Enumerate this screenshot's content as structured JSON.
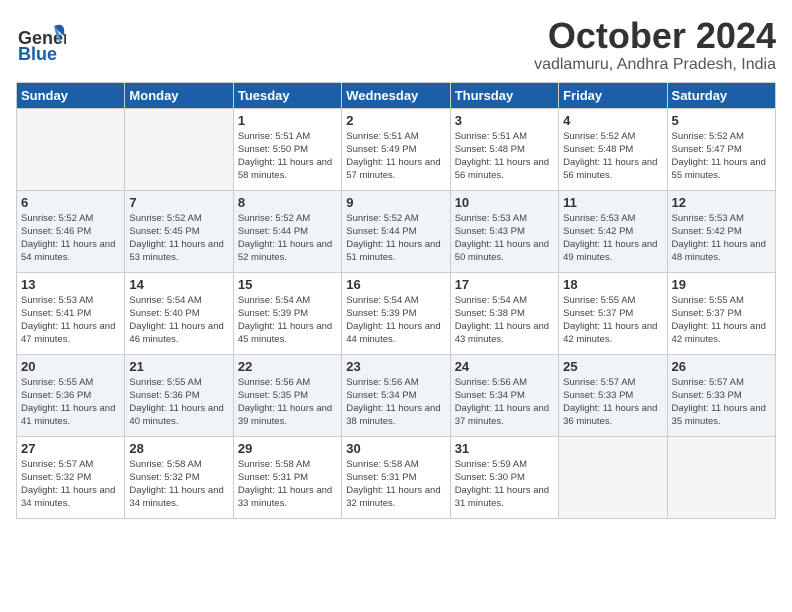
{
  "header": {
    "logo_general": "General",
    "logo_blue": "Blue",
    "month": "October 2024",
    "location": "vadlamuru, Andhra Pradesh, India"
  },
  "days_of_week": [
    "Sunday",
    "Monday",
    "Tuesday",
    "Wednesday",
    "Thursday",
    "Friday",
    "Saturday"
  ],
  "weeks": [
    [
      {
        "day": "",
        "empty": true
      },
      {
        "day": "",
        "empty": true
      },
      {
        "day": "1",
        "sunrise": "5:51 AM",
        "sunset": "5:50 PM",
        "daylight": "11 hours and 58 minutes."
      },
      {
        "day": "2",
        "sunrise": "5:51 AM",
        "sunset": "5:49 PM",
        "daylight": "11 hours and 57 minutes."
      },
      {
        "day": "3",
        "sunrise": "5:51 AM",
        "sunset": "5:48 PM",
        "daylight": "11 hours and 56 minutes."
      },
      {
        "day": "4",
        "sunrise": "5:52 AM",
        "sunset": "5:48 PM",
        "daylight": "11 hours and 56 minutes."
      },
      {
        "day": "5",
        "sunrise": "5:52 AM",
        "sunset": "5:47 PM",
        "daylight": "11 hours and 55 minutes."
      }
    ],
    [
      {
        "day": "6",
        "sunrise": "5:52 AM",
        "sunset": "5:46 PM",
        "daylight": "11 hours and 54 minutes."
      },
      {
        "day": "7",
        "sunrise": "5:52 AM",
        "sunset": "5:45 PM",
        "daylight": "11 hours and 53 minutes."
      },
      {
        "day": "8",
        "sunrise": "5:52 AM",
        "sunset": "5:44 PM",
        "daylight": "11 hours and 52 minutes."
      },
      {
        "day": "9",
        "sunrise": "5:52 AM",
        "sunset": "5:44 PM",
        "daylight": "11 hours and 51 minutes."
      },
      {
        "day": "10",
        "sunrise": "5:53 AM",
        "sunset": "5:43 PM",
        "daylight": "11 hours and 50 minutes."
      },
      {
        "day": "11",
        "sunrise": "5:53 AM",
        "sunset": "5:42 PM",
        "daylight": "11 hours and 49 minutes."
      },
      {
        "day": "12",
        "sunrise": "5:53 AM",
        "sunset": "5:42 PM",
        "daylight": "11 hours and 48 minutes."
      }
    ],
    [
      {
        "day": "13",
        "sunrise": "5:53 AM",
        "sunset": "5:41 PM",
        "daylight": "11 hours and 47 minutes."
      },
      {
        "day": "14",
        "sunrise": "5:54 AM",
        "sunset": "5:40 PM",
        "daylight": "11 hours and 46 minutes."
      },
      {
        "day": "15",
        "sunrise": "5:54 AM",
        "sunset": "5:39 PM",
        "daylight": "11 hours and 45 minutes."
      },
      {
        "day": "16",
        "sunrise": "5:54 AM",
        "sunset": "5:39 PM",
        "daylight": "11 hours and 44 minutes."
      },
      {
        "day": "17",
        "sunrise": "5:54 AM",
        "sunset": "5:38 PM",
        "daylight": "11 hours and 43 minutes."
      },
      {
        "day": "18",
        "sunrise": "5:55 AM",
        "sunset": "5:37 PM",
        "daylight": "11 hours and 42 minutes."
      },
      {
        "day": "19",
        "sunrise": "5:55 AM",
        "sunset": "5:37 PM",
        "daylight": "11 hours and 42 minutes."
      }
    ],
    [
      {
        "day": "20",
        "sunrise": "5:55 AM",
        "sunset": "5:36 PM",
        "daylight": "11 hours and 41 minutes."
      },
      {
        "day": "21",
        "sunrise": "5:55 AM",
        "sunset": "5:36 PM",
        "daylight": "11 hours and 40 minutes."
      },
      {
        "day": "22",
        "sunrise": "5:56 AM",
        "sunset": "5:35 PM",
        "daylight": "11 hours and 39 minutes."
      },
      {
        "day": "23",
        "sunrise": "5:56 AM",
        "sunset": "5:34 PM",
        "daylight": "11 hours and 38 minutes."
      },
      {
        "day": "24",
        "sunrise": "5:56 AM",
        "sunset": "5:34 PM",
        "daylight": "11 hours and 37 minutes."
      },
      {
        "day": "25",
        "sunrise": "5:57 AM",
        "sunset": "5:33 PM",
        "daylight": "11 hours and 36 minutes."
      },
      {
        "day": "26",
        "sunrise": "5:57 AM",
        "sunset": "5:33 PM",
        "daylight": "11 hours and 35 minutes."
      }
    ],
    [
      {
        "day": "27",
        "sunrise": "5:57 AM",
        "sunset": "5:32 PM",
        "daylight": "11 hours and 34 minutes."
      },
      {
        "day": "28",
        "sunrise": "5:58 AM",
        "sunset": "5:32 PM",
        "daylight": "11 hours and 34 minutes."
      },
      {
        "day": "29",
        "sunrise": "5:58 AM",
        "sunset": "5:31 PM",
        "daylight": "11 hours and 33 minutes."
      },
      {
        "day": "30",
        "sunrise": "5:58 AM",
        "sunset": "5:31 PM",
        "daylight": "11 hours and 32 minutes."
      },
      {
        "day": "31",
        "sunrise": "5:59 AM",
        "sunset": "5:30 PM",
        "daylight": "11 hours and 31 minutes."
      },
      {
        "day": "",
        "empty": true
      },
      {
        "day": "",
        "empty": true
      }
    ]
  ]
}
